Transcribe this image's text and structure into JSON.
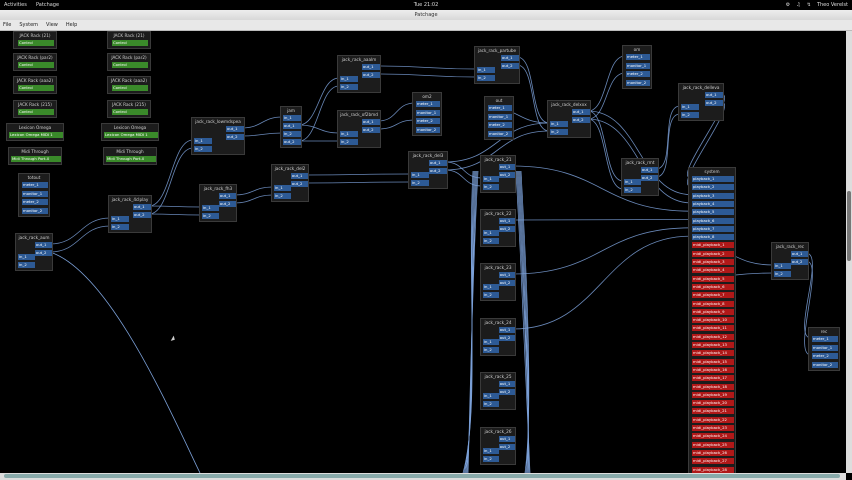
{
  "topbar": {
    "activities": "Activities",
    "app_name": "Patchage",
    "clock": "Tue 21:02",
    "user": "Theo Verelst"
  },
  "window": {
    "title": "Patchage"
  },
  "menu": {
    "items": [
      "File",
      "System",
      "View",
      "Help"
    ]
  },
  "modules": [
    {
      "title": "JACK Rack (21)",
      "ports": [
        {
          "label": "Control",
          "kind": "g"
        }
      ]
    },
    {
      "title": "JACK Rack (21)",
      "ports": [
        {
          "label": "Control",
          "kind": "g"
        }
      ]
    },
    {
      "title": "JACK Rack (par2)",
      "ports": [
        {
          "label": "Control",
          "kind": "g"
        }
      ]
    },
    {
      "title": "JACK Rack (par2)",
      "ports": [
        {
          "label": "Control",
          "kind": "g"
        }
      ]
    },
    {
      "title": "JACK Rack (aaa2)",
      "ports": [
        {
          "label": "Control",
          "kind": "g"
        }
      ]
    },
    {
      "title": "JACK Rack (aaa2)",
      "ports": [
        {
          "label": "Control",
          "kind": "g"
        }
      ]
    },
    {
      "title": "JACK Rack (215)",
      "ports": [
        {
          "label": "Control",
          "kind": "g"
        }
      ]
    },
    {
      "title": "JACK Rack (215)",
      "ports": [
        {
          "label": "Control",
          "kind": "g"
        }
      ]
    },
    {
      "title": "Lexicon Omega",
      "ports": [
        {
          "label": "Lexicon Omega MIDI 1",
          "kind": "g"
        }
      ]
    },
    {
      "title": "Lexicon Omega",
      "ports": [
        {
          "label": "Lexicon Omega MIDI 1",
          "kind": "g"
        }
      ]
    },
    {
      "title": "Midi Through",
      "ports": [
        {
          "label": "Midi Through Port-0",
          "kind": "g"
        }
      ]
    },
    {
      "title": "Midi Through",
      "ports": [
        {
          "label": "Midi Through Port-0",
          "kind": "g"
        }
      ]
    },
    {
      "title": "totout",
      "ports": [
        {
          "label": "meter_1"
        },
        {
          "label": "monitor_1"
        },
        {
          "label": "meter_2"
        },
        {
          "label": "monitor_2"
        }
      ]
    },
    {
      "title": "jack_rack_aum",
      "ports": [
        {
          "label": "out_1"
        },
        {
          "label": "out_2"
        },
        {
          "label": "in_1"
        },
        {
          "label": "in_2"
        }
      ]
    },
    {
      "title": "jack_rack_4clplay",
      "ports": [
        {
          "label": "out_1"
        },
        {
          "label": "out_2"
        },
        {
          "label": "in_1"
        },
        {
          "label": "in_2"
        }
      ]
    },
    {
      "title": "jack_rack_fh3",
      "ports": [
        {
          "label": "out_1"
        },
        {
          "label": "out_2"
        },
        {
          "label": "in_1"
        },
        {
          "label": "in_2"
        }
      ]
    },
    {
      "title": "jack_rack_lowmdspea",
      "ports": [
        {
          "label": "out_1"
        },
        {
          "label": "out_2"
        },
        {
          "label": "in_1"
        },
        {
          "label": "in_2"
        }
      ]
    },
    {
      "title": "jam",
      "ports": [
        {
          "label": "in_1"
        },
        {
          "label": "out_1"
        },
        {
          "label": "in_2"
        },
        {
          "label": "out_2"
        }
      ]
    },
    {
      "title": "jack_rack_del2",
      "ports": [
        {
          "label": "out_1"
        },
        {
          "label": "out_2"
        },
        {
          "label": "in_1"
        },
        {
          "label": "in_2"
        }
      ]
    },
    {
      "title": "jack_rack_aaalm",
      "ports": [
        {
          "label": "out_1"
        },
        {
          "label": "out_2"
        },
        {
          "label": "in_1"
        },
        {
          "label": "in_2"
        }
      ]
    },
    {
      "title": "jack_rack_of2bmd",
      "ports": [
        {
          "label": "out_1"
        },
        {
          "label": "out_2"
        },
        {
          "label": "in_1"
        },
        {
          "label": "in_2"
        }
      ]
    },
    {
      "title": "om2",
      "ports": [
        {
          "label": "meter_1"
        },
        {
          "label": "monitor_1"
        },
        {
          "label": "meter_2"
        },
        {
          "label": "monitor_2"
        }
      ]
    },
    {
      "title": "jack_rack_del3",
      "ports": [
        {
          "label": "out_1"
        },
        {
          "label": "out_2"
        },
        {
          "label": "in_1"
        },
        {
          "label": "in_2"
        }
      ]
    },
    {
      "title": "jack_rack_partube",
      "ports": [
        {
          "label": "out_1"
        },
        {
          "label": "out_2"
        },
        {
          "label": "in_1"
        },
        {
          "label": "in_2"
        }
      ]
    },
    {
      "title": "out",
      "ports": [
        {
          "label": "meter_1"
        },
        {
          "label": "monitor_1"
        },
        {
          "label": "meter_2"
        },
        {
          "label": "monitor_2"
        }
      ]
    },
    {
      "title": "jack_rack_delxxx",
      "ports": [
        {
          "label": "out_1"
        },
        {
          "label": "out_2"
        },
        {
          "label": "in_1"
        },
        {
          "label": "in_2"
        }
      ]
    },
    {
      "title": "om",
      "ports": [
        {
          "label": "meter_1"
        },
        {
          "label": "monitor_1"
        },
        {
          "label": "meter_2"
        },
        {
          "label": "monitor_2"
        }
      ]
    },
    {
      "title": "jack_rack_rmt",
      "ports": [
        {
          "label": "out_1"
        },
        {
          "label": "out_2"
        },
        {
          "label": "in_1"
        },
        {
          "label": "in_2"
        }
      ]
    },
    {
      "title": "jack_rack_delleva",
      "ports": [
        {
          "label": "out_1"
        },
        {
          "label": "out_2"
        },
        {
          "label": "in_1"
        },
        {
          "label": "in_2"
        }
      ]
    },
    {
      "title": "jack_rack_21",
      "ports": [
        {
          "label": "out_1"
        },
        {
          "label": "out_2"
        },
        {
          "label": "in_1"
        },
        {
          "label": "in_2"
        }
      ]
    },
    {
      "title": "jack_rack_22",
      "ports": [
        {
          "label": "out_1"
        },
        {
          "label": "out_2"
        },
        {
          "label": "in_1"
        },
        {
          "label": "in_2"
        }
      ]
    },
    {
      "title": "jack_rack_23",
      "ports": [
        {
          "label": "out_1"
        },
        {
          "label": "out_2"
        },
        {
          "label": "in_1"
        },
        {
          "label": "in_2"
        }
      ]
    },
    {
      "title": "jack_rack_24",
      "ports": [
        {
          "label": "out_1"
        },
        {
          "label": "out_2"
        },
        {
          "label": "in_1"
        },
        {
          "label": "in_2"
        }
      ]
    },
    {
      "title": "jack_rack_25",
      "ports": [
        {
          "label": "out_1"
        },
        {
          "label": "out_2"
        },
        {
          "label": "in_1"
        },
        {
          "label": "in_2"
        }
      ]
    },
    {
      "title": "jack_rack_26",
      "ports": [
        {
          "label": "out_1"
        },
        {
          "label": "out_2"
        },
        {
          "label": "in_1"
        },
        {
          "label": "in_2"
        }
      ]
    },
    {
      "title": "system",
      "ports": [
        {
          "label": "playback_1"
        },
        {
          "label": "playback_2"
        },
        {
          "label": "playback_3"
        },
        {
          "label": "playback_4"
        },
        {
          "label": "playback_5"
        },
        {
          "label": "playback_6"
        },
        {
          "label": "playback_7"
        },
        {
          "label": "playback_8"
        },
        {
          "label": "midi_playback_1",
          "kind": "r"
        },
        {
          "label": "midi_playback_2",
          "kind": "r"
        },
        {
          "label": "midi_playback_3",
          "kind": "r"
        },
        {
          "label": "midi_playback_4",
          "kind": "r"
        },
        {
          "label": "midi_playback_5",
          "kind": "r"
        },
        {
          "label": "midi_playback_6",
          "kind": "r"
        },
        {
          "label": "midi_playback_7",
          "kind": "r"
        },
        {
          "label": "midi_playback_8",
          "kind": "r"
        },
        {
          "label": "midi_playback_9",
          "kind": "r"
        },
        {
          "label": "midi_playback_10",
          "kind": "r"
        },
        {
          "label": "midi_playback_11",
          "kind": "r"
        },
        {
          "label": "midi_playback_12",
          "kind": "r"
        },
        {
          "label": "midi_playback_13",
          "kind": "r"
        },
        {
          "label": "midi_playback_14",
          "kind": "r"
        },
        {
          "label": "midi_playback_15",
          "kind": "r"
        },
        {
          "label": "midi_playback_16",
          "kind": "r"
        },
        {
          "label": "midi_playback_17",
          "kind": "r"
        },
        {
          "label": "midi_playback_18",
          "kind": "r"
        },
        {
          "label": "midi_playback_19",
          "kind": "r"
        },
        {
          "label": "midi_playback_20",
          "kind": "r"
        },
        {
          "label": "midi_playback_21",
          "kind": "r"
        },
        {
          "label": "midi_playback_22",
          "kind": "r"
        },
        {
          "label": "midi_playback_23",
          "kind": "r"
        },
        {
          "label": "midi_playback_24",
          "kind": "r"
        },
        {
          "label": "midi_playback_25",
          "kind": "r"
        },
        {
          "label": "midi_playback_26",
          "kind": "r"
        },
        {
          "label": "midi_playback_27",
          "kind": "r"
        },
        {
          "label": "midi_playback_28",
          "kind": "r"
        }
      ]
    },
    {
      "title": "jack_rack_rec",
      "ports": [
        {
          "label": "out_1"
        },
        {
          "label": "out_2"
        },
        {
          "label": "in_1"
        },
        {
          "label": "in_2"
        }
      ]
    },
    {
      "title": "rec",
      "ports": [
        {
          "label": "meter_1"
        },
        {
          "label": "monitor_1"
        },
        {
          "label": "meter_2"
        },
        {
          "label": "monitor_2"
        }
      ]
    }
  ]
}
